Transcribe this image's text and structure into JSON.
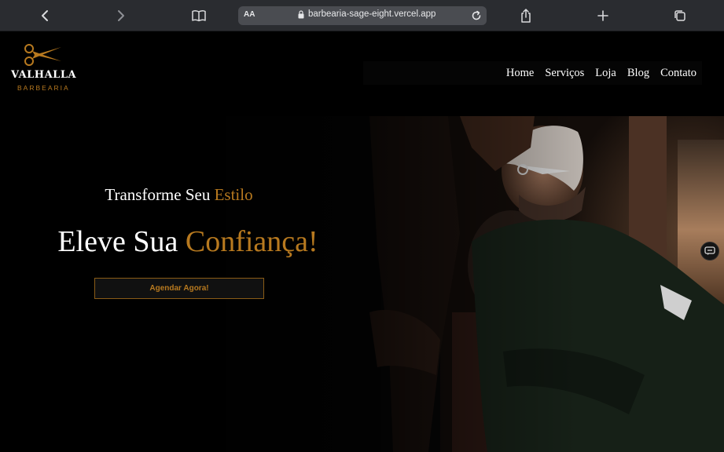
{
  "browser": {
    "aa_label": "AA",
    "url": "barbearia-sage-eight.vercel.app",
    "icons": [
      "back-icon",
      "forward-icon",
      "bookmarks-icon",
      "lock-icon",
      "reload-icon",
      "share-icon",
      "new-tab-icon",
      "tabs-icon"
    ]
  },
  "site": {
    "logo": {
      "name": "VALHALLA",
      "subtitle": "BARBEARIA",
      "icon": "scissors-icon"
    },
    "nav": [
      {
        "label": "Home"
      },
      {
        "label": "Serviços"
      },
      {
        "label": "Loja"
      },
      {
        "label": "Blog"
      },
      {
        "label": "Contato"
      }
    ],
    "hero": {
      "subtitle_white": "Transforme Seu",
      "subtitle_gold": "Estilo",
      "headline_white": "Eleve Sua",
      "headline_gold": "Confiança!",
      "cta_label": "Agendar Agora!",
      "image_alt": "barber-photo"
    },
    "chat_icon": "chat-widget-icon"
  },
  "colors": {
    "accent": "#b7791f",
    "background": "#000000",
    "toolbar": "#2a2c30",
    "url_bar": "#4a4c51"
  }
}
